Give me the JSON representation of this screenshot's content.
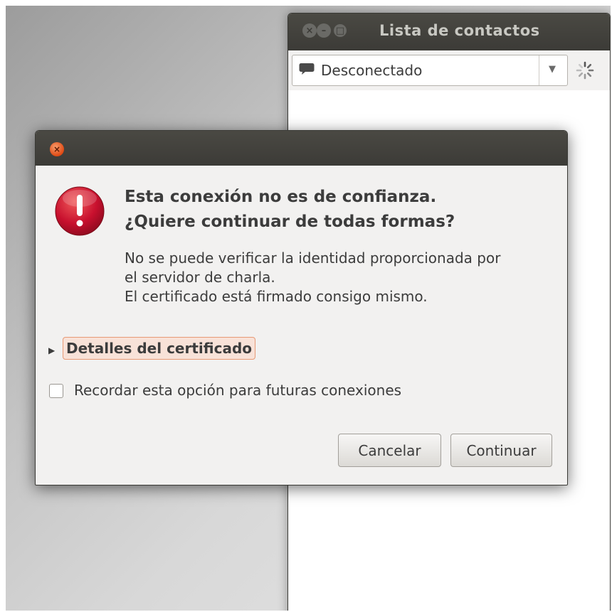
{
  "contacts_window": {
    "title": "Lista de contactos",
    "status_value": "Desconectado"
  },
  "dialog": {
    "primary_line1": "Esta conexión no es de confianza.",
    "primary_line2": "¿Quiere continuar de todas formas?",
    "secondary_line1": "No se puede verificar la identidad proporcionada por",
    "secondary_line2": "el servidor de charla.",
    "secondary_line3": "El certificado está firmado consigo mismo.",
    "expander_label": "Detalles del certificado",
    "remember_label": "Recordar esta opción para futuras conexiones",
    "remember_checked": false,
    "cancel_label": "Cancelar",
    "continue_label": "Continuar"
  },
  "icons": {
    "window_controls": [
      "close-icon",
      "minimize-icon",
      "maximize-icon"
    ],
    "status": "speech-bubble-icon",
    "busy": "spinner-icon",
    "dialog": "warning-icon"
  },
  "colors": {
    "titlebar": "#3c3b37",
    "dialog_background": "#f2f1f0",
    "close_button": "#df4a14",
    "warning_red": "#c8102e",
    "expander_highlight": "#f8e2d8"
  }
}
